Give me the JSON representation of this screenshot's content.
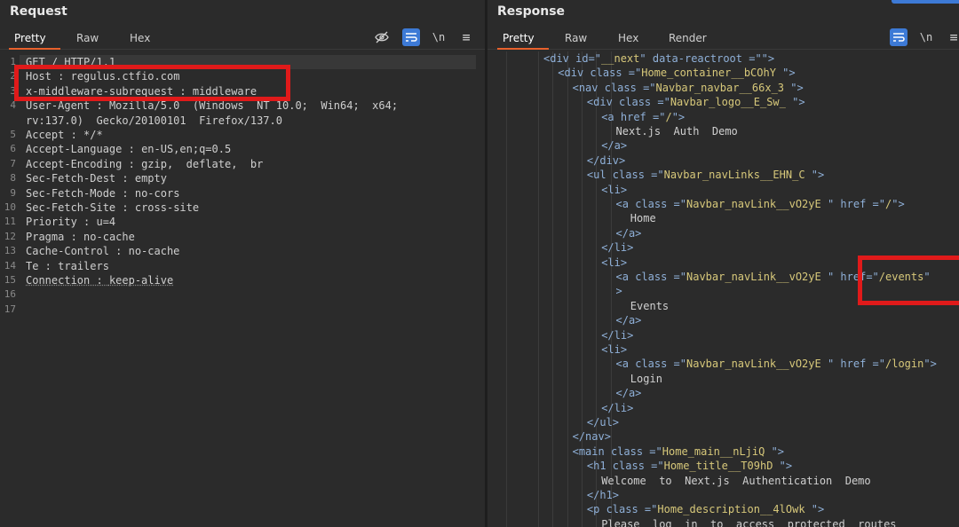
{
  "request": {
    "title": "Request",
    "tabs": [
      "Pretty",
      "Raw",
      "Hex"
    ],
    "active_tab": "Pretty",
    "tools": {
      "hide": "eye-off-icon",
      "wrap": "wrap-icon",
      "newline": "\\n",
      "menu": "≡"
    },
    "lines": [
      {
        "n": "1",
        "key": "GET / HTTP/1.1",
        "val": ""
      },
      {
        "n": "2",
        "key": "Host",
        "val": "regulus.ctfio.com"
      },
      {
        "n": "3",
        "key": "x-middleware-subrequest",
        "val": "middleware"
      },
      {
        "n": "4",
        "key": "User-Agent",
        "val": "Mozilla/5.0  (Windows  NT 10.0;  Win64;  x64;"
      },
      {
        "n": "",
        "key": "",
        "val": "rv:137.0)  Gecko/20100101  Firefox/137.0"
      },
      {
        "n": "5",
        "key": "Accept",
        "val": "*/*"
      },
      {
        "n": "6",
        "key": "Accept-Language",
        "val": "en-US,en;q=0.5"
      },
      {
        "n": "7",
        "key": "Accept-Encoding",
        "val": "gzip,  deflate,  br"
      },
      {
        "n": "8",
        "key": "Sec-Fetch-Dest",
        "val": "empty"
      },
      {
        "n": "9",
        "key": "Sec-Fetch-Mode",
        "val": "no-cors"
      },
      {
        "n": "10",
        "key": "Sec-Fetch-Site",
        "val": "cross-site"
      },
      {
        "n": "11",
        "key": "Priority",
        "val": "u=4"
      },
      {
        "n": "12",
        "key": "Pragma",
        "val": "no-cache"
      },
      {
        "n": "13",
        "key": "Cache-Control",
        "val": "no-cache"
      },
      {
        "n": "14",
        "key": "Te",
        "val": "trailers"
      },
      {
        "n": "15",
        "key": "Connection",
        "val": "keep-alive"
      },
      {
        "n": "16",
        "key": "",
        "val": ""
      },
      {
        "n": "17",
        "key": "",
        "val": ""
      }
    ]
  },
  "response": {
    "title": "Response",
    "tabs": [
      "Pretty",
      "Raw",
      "Hex",
      "Render"
    ],
    "active_tab": "Pretty",
    "tools": {
      "wrap": "wrap-icon",
      "newline": "\\n",
      "menu": "≡"
    },
    "lines": [
      {
        "i": 0,
        "parts": [
          [
            "tag",
            "<div "
          ],
          [
            "attr",
            "id"
          ],
          [
            "tag",
            "=\""
          ],
          [
            "str",
            "__next"
          ],
          [
            "tag",
            "\" "
          ],
          [
            "attr",
            "data-reactroot"
          ],
          [
            "tag",
            " =\"\">"
          ]
        ]
      },
      {
        "i": 1,
        "parts": [
          [
            "tag",
            "<div "
          ],
          [
            "attr",
            "class"
          ],
          [
            "tag",
            " =\""
          ],
          [
            "str",
            "Home_container__bCOhY"
          ],
          [
            "tag",
            " \">"
          ]
        ]
      },
      {
        "i": 2,
        "parts": [
          [
            "tag",
            "<nav "
          ],
          [
            "attr",
            "class"
          ],
          [
            "tag",
            " =\""
          ],
          [
            "str",
            "Navbar_navbar__66x_3"
          ],
          [
            "tag",
            " \">"
          ]
        ]
      },
      {
        "i": 3,
        "parts": [
          [
            "tag",
            "<div "
          ],
          [
            "attr",
            "class"
          ],
          [
            "tag",
            " =\""
          ],
          [
            "str",
            "Navbar_logo__E_Sw_"
          ],
          [
            "tag",
            " \">"
          ]
        ]
      },
      {
        "i": 4,
        "parts": [
          [
            "tag",
            "<a "
          ],
          [
            "attr",
            "href"
          ],
          [
            "tag",
            " =\""
          ],
          [
            "str",
            "/"
          ],
          [
            "tag",
            "\">"
          ]
        ]
      },
      {
        "i": 5,
        "parts": [
          [
            "txt",
            "Next.js  Auth  Demo"
          ]
        ]
      },
      {
        "i": 4,
        "parts": [
          [
            "tag",
            "</a>"
          ]
        ]
      },
      {
        "i": 3,
        "parts": [
          [
            "tag",
            "</div>"
          ]
        ]
      },
      {
        "i": 3,
        "parts": [
          [
            "tag",
            "<ul "
          ],
          [
            "attr",
            "class"
          ],
          [
            "tag",
            " =\""
          ],
          [
            "str",
            "Navbar_navLinks__EHN_C"
          ],
          [
            "tag",
            " \">"
          ]
        ]
      },
      {
        "i": 4,
        "parts": [
          [
            "tag",
            "<li>"
          ]
        ]
      },
      {
        "i": 5,
        "parts": [
          [
            "tag",
            "<a "
          ],
          [
            "attr",
            "class"
          ],
          [
            "tag",
            " =\""
          ],
          [
            "str",
            "Navbar_navLink__vO2yE"
          ],
          [
            "tag",
            " \" "
          ],
          [
            "attr",
            "href"
          ],
          [
            "tag",
            " =\""
          ],
          [
            "str",
            "/"
          ],
          [
            "tag",
            "\">"
          ]
        ]
      },
      {
        "i": 6,
        "parts": [
          [
            "txt",
            "Home"
          ]
        ]
      },
      {
        "i": 5,
        "parts": [
          [
            "tag",
            "</a>"
          ]
        ]
      },
      {
        "i": 4,
        "parts": [
          [
            "tag",
            "</li>"
          ]
        ]
      },
      {
        "i": 4,
        "parts": [
          [
            "tag",
            "<li>"
          ]
        ]
      },
      {
        "i": 5,
        "parts": [
          [
            "tag",
            "<a "
          ],
          [
            "attr",
            "class"
          ],
          [
            "tag",
            " =\""
          ],
          [
            "str",
            "Navbar_navLink__vO2yE"
          ],
          [
            "tag",
            " \" "
          ],
          [
            "attr",
            "href"
          ],
          [
            "tag",
            "=\""
          ],
          [
            "str",
            "/events"
          ],
          [
            "tag",
            "\""
          ]
        ]
      },
      {
        "i": 5,
        "parts": [
          [
            "tag",
            ">"
          ]
        ]
      },
      {
        "i": 6,
        "parts": [
          [
            "txt",
            "Events"
          ]
        ]
      },
      {
        "i": 5,
        "parts": [
          [
            "tag",
            "</a>"
          ]
        ]
      },
      {
        "i": 4,
        "parts": [
          [
            "tag",
            "</li>"
          ]
        ]
      },
      {
        "i": 4,
        "parts": [
          [
            "tag",
            "<li>"
          ]
        ]
      },
      {
        "i": 5,
        "parts": [
          [
            "tag",
            "<a "
          ],
          [
            "attr",
            "class"
          ],
          [
            "tag",
            " =\""
          ],
          [
            "str",
            "Navbar_navLink__vO2yE"
          ],
          [
            "tag",
            " \" "
          ],
          [
            "attr",
            "href"
          ],
          [
            "tag",
            " =\""
          ],
          [
            "str",
            "/login"
          ],
          [
            "tag",
            "\">"
          ]
        ]
      },
      {
        "i": 6,
        "parts": [
          [
            "txt",
            "Login"
          ]
        ]
      },
      {
        "i": 5,
        "parts": [
          [
            "tag",
            "</a>"
          ]
        ]
      },
      {
        "i": 4,
        "parts": [
          [
            "tag",
            "</li>"
          ]
        ]
      },
      {
        "i": 3,
        "parts": [
          [
            "tag",
            "</ul>"
          ]
        ]
      },
      {
        "i": 2,
        "parts": [
          [
            "tag",
            "</nav>"
          ]
        ]
      },
      {
        "i": 2,
        "parts": [
          [
            "tag",
            "<main "
          ],
          [
            "attr",
            "class"
          ],
          [
            "tag",
            " =\""
          ],
          [
            "str",
            "Home_main__nLjiQ"
          ],
          [
            "tag",
            " \">"
          ]
        ]
      },
      {
        "i": 3,
        "parts": [
          [
            "tag",
            "<h1 "
          ],
          [
            "attr",
            "class"
          ],
          [
            "tag",
            " =\""
          ],
          [
            "str",
            "Home_title__T09hD"
          ],
          [
            "tag",
            " \">"
          ]
        ]
      },
      {
        "i": 4,
        "parts": [
          [
            "txt",
            "Welcome  to  Next.js  Authentication  Demo"
          ]
        ]
      },
      {
        "i": 3,
        "parts": [
          [
            "tag",
            "</h1>"
          ]
        ]
      },
      {
        "i": 3,
        "parts": [
          [
            "tag",
            "<p "
          ],
          [
            "attr",
            "class"
          ],
          [
            "tag",
            " =\""
          ],
          [
            "str",
            "Home_description__4lOwk"
          ],
          [
            "tag",
            " \">"
          ]
        ]
      },
      {
        "i": 4,
        "parts": [
          [
            "txt",
            "Please  log  in  to  access  protected  routes"
          ]
        ]
      }
    ]
  },
  "colors": {
    "accent": "#e8612c",
    "highlight": "#e01a1a",
    "tool_blue": "#3d7ad6"
  }
}
